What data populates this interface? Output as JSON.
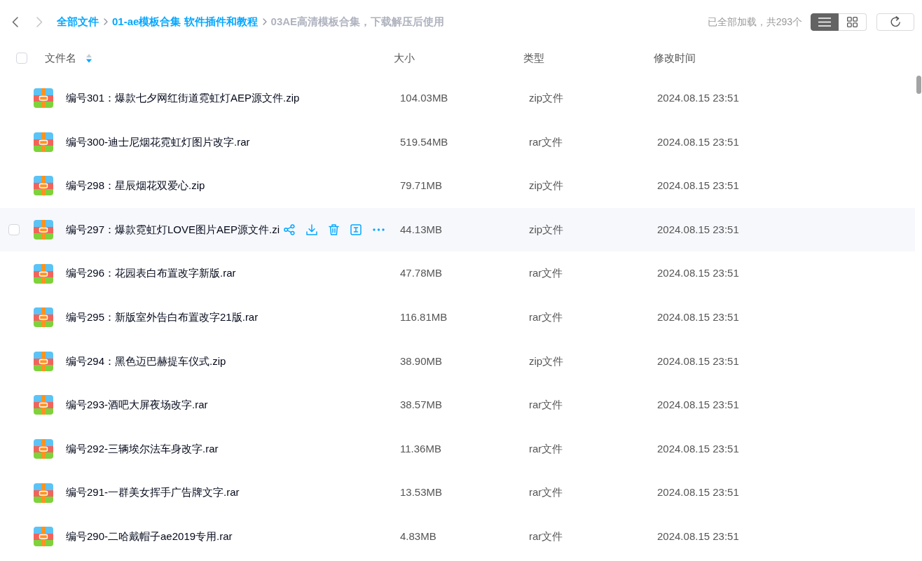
{
  "nav": {
    "back": {
      "disabled": false
    },
    "forward": {
      "disabled": true
    }
  },
  "breadcrumb": [
    {
      "label": "全部文件",
      "current": false
    },
    {
      "label": "01-ae模板合集 软件插件和教程",
      "current": false
    },
    {
      "label": "03AE高清模板合集，下载解压后使用",
      "current": true
    }
  ],
  "load_status": "已全部加载，共293个",
  "view_modes": [
    {
      "kind": "list",
      "selected": true
    },
    {
      "kind": "grid",
      "selected": false
    }
  ],
  "table": {
    "select_all": {
      "checked": false
    },
    "columns": [
      {
        "label": "文件名",
        "sorted": true,
        "descending": true
      },
      {
        "label": "大小",
        "sorted": false
      },
      {
        "label": "类型",
        "sorted": false
      },
      {
        "label": "修改时间",
        "sorted": false
      }
    ],
    "rows": [
      {
        "name": "编号301：爆款七夕网红街道霓虹灯AEP源文件.zip",
        "size": "104.03MB",
        "type": "zip文件",
        "modified": "2024.08.15 23:51",
        "hovered": false,
        "checked": false
      },
      {
        "name": "编号300-迪士尼烟花霓虹灯图片改字.rar",
        "size": "519.54MB",
        "type": "rar文件",
        "modified": "2024.08.15 23:51",
        "hovered": false,
        "checked": false
      },
      {
        "name": "编号298：星辰烟花双爱心.zip",
        "size": "79.71MB",
        "type": "zip文件",
        "modified": "2024.08.15 23:51",
        "hovered": false,
        "checked": false
      },
      {
        "name": "编号297：爆款霓虹灯LOVE图片AEP源文件.zi",
        "size": "44.13MB",
        "type": "zip文件",
        "modified": "2024.08.15 23:51",
        "hovered": true,
        "checked": false
      },
      {
        "name": "编号296：花园表白布置改字新版.rar",
        "size": "47.78MB",
        "type": "rar文件",
        "modified": "2024.08.15 23:51",
        "hovered": false,
        "checked": false
      },
      {
        "name": "编号295：新版室外告白布置改字21版.rar",
        "size": "116.81MB",
        "type": "rar文件",
        "modified": "2024.08.15 23:51",
        "hovered": false,
        "checked": false
      },
      {
        "name": "编号294：黑色迈巴赫提车仪式.zip",
        "size": "38.90MB",
        "type": "zip文件",
        "modified": "2024.08.15 23:51",
        "hovered": false,
        "checked": false
      },
      {
        "name": "编号293-酒吧大屏夜场改字.rar",
        "size": "38.57MB",
        "type": "rar文件",
        "modified": "2024.08.15 23:51",
        "hovered": false,
        "checked": false
      },
      {
        "name": "编号292-三辆埃尔法车身改字.rar",
        "size": "11.36MB",
        "type": "rar文件",
        "modified": "2024.08.15 23:51",
        "hovered": false,
        "checked": false
      },
      {
        "name": "编号291-一群美女挥手广告牌文字.rar",
        "size": "13.53MB",
        "type": "rar文件",
        "modified": "2024.08.15 23:51",
        "hovered": false,
        "checked": false
      },
      {
        "name": "编号290-二哈戴帽子ae2019专用.rar",
        "size": "4.83MB",
        "type": "rar文件",
        "modified": "2024.08.15 23:51",
        "hovered": false,
        "checked": false
      }
    ]
  }
}
